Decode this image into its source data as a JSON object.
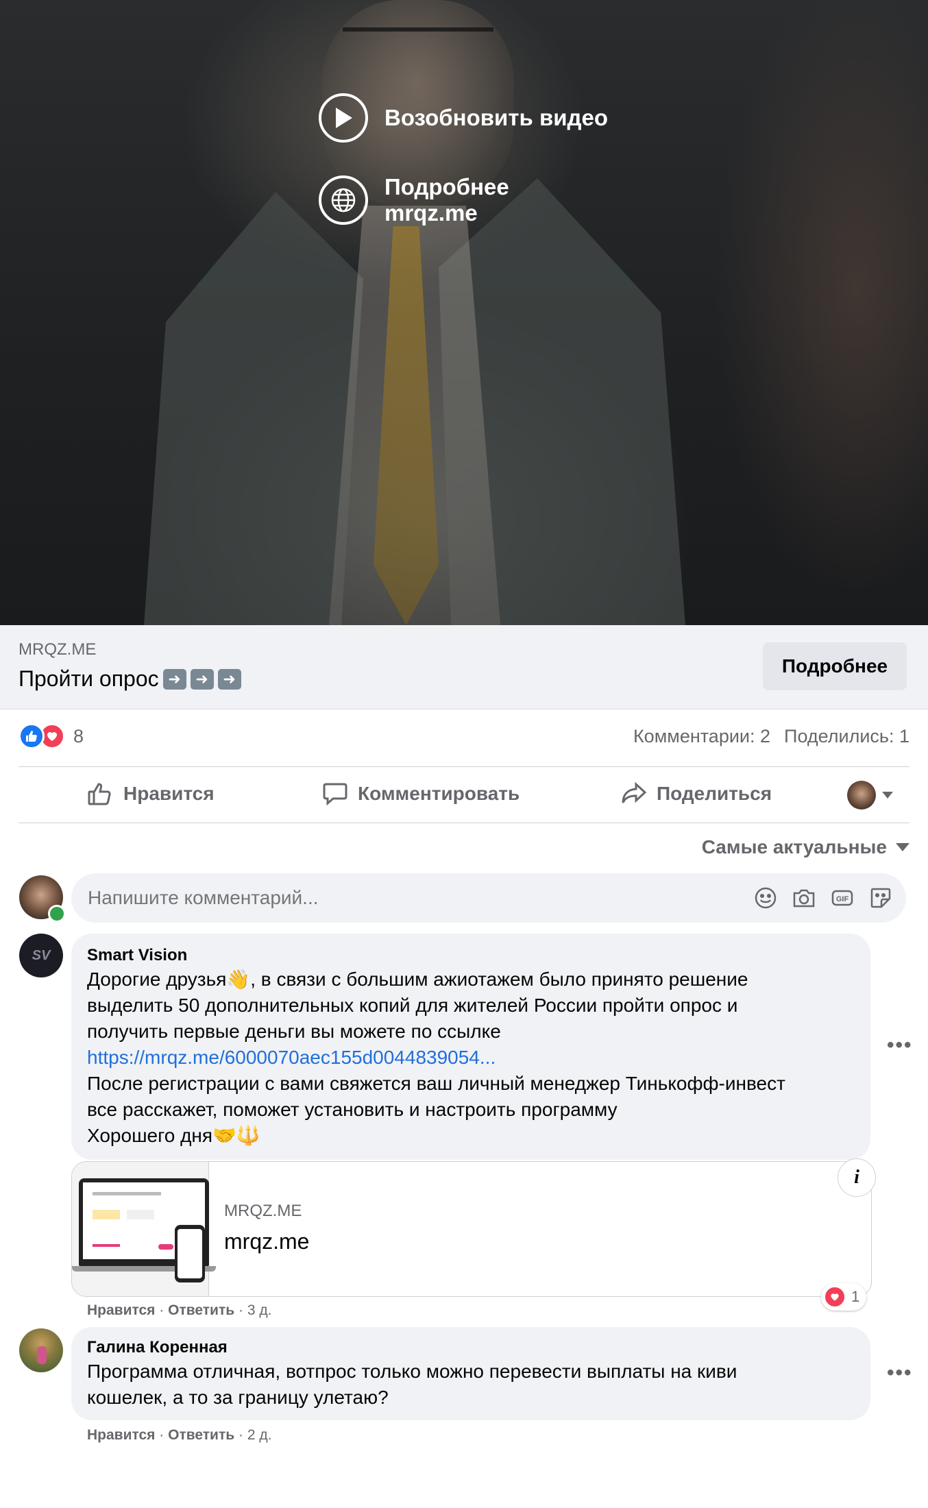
{
  "video": {
    "resume_label": "Возобновить видео",
    "more_title": "Подробнее",
    "more_domain": "mrqz.me"
  },
  "ad": {
    "domain": "MRQZ.ME",
    "title": "Пройти опрос",
    "title_emoji": "➡️➡️➡️",
    "button": "Подробнее"
  },
  "reactions": {
    "count": "8",
    "comments": "Комментарии: 2",
    "shares": "Поделились: 1"
  },
  "actions": {
    "like": "Нравится",
    "comment": "Комментировать",
    "share": "Поделиться"
  },
  "sort_label": "Самые актуальные",
  "comment_input": {
    "placeholder": "Напишите комментарий..."
  },
  "comments": [
    {
      "author": "Smart Vision",
      "avatar_text": "SV",
      "line1": "Дорогие друзья👋, в связи с большим ажиотажем было принято решение",
      "line2": "выделить 50 дополнительных копий для жителей России пройти опрос и",
      "line3": "получить первые деньги вы можете по ссылке",
      "link": "https://mrqz.me/6000070aec155d0044839054...",
      "line5": "После регистрации с вами свяжется ваш личный менеджер Тинькофф-инвест",
      "line6": "все расскажет, поможет установить и настроить программу",
      "line7": "Хорошего дня🤝🔱",
      "preview_domain": "MRQZ.ME",
      "preview_title": "mrqz.me",
      "like": "Нравится",
      "reply": "Ответить",
      "time": "3 д.",
      "reaction_count": "1"
    },
    {
      "author": "Галина Коренная",
      "line1": "Программа отличная, вотпрос только можно перевести выплаты на киви",
      "line2": "кошелек, а то за границу улетаю?",
      "like": "Нравится",
      "reply": "Ответить",
      "time": "2 д."
    }
  ],
  "colors": {
    "like_blue": "#1877f2",
    "love_red": "#f33e58",
    "link_blue": "#216fdb",
    "online_green": "#31a24c"
  }
}
